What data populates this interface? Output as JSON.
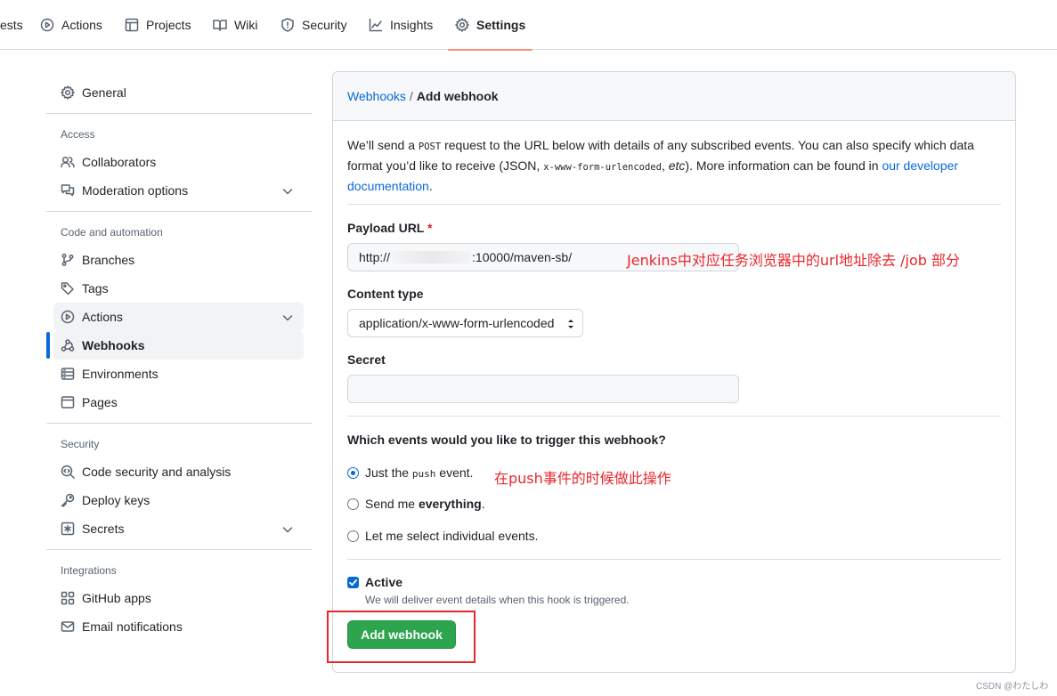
{
  "topnav": {
    "tabs": [
      {
        "label": "ests",
        "icon": "partial-tab"
      },
      {
        "label": "Actions",
        "icon": "play-icon"
      },
      {
        "label": "Projects",
        "icon": "table-icon"
      },
      {
        "label": "Wiki",
        "icon": "book-icon"
      },
      {
        "label": "Security",
        "icon": "shield-icon"
      },
      {
        "label": "Insights",
        "icon": "graph-icon"
      },
      {
        "label": "Settings",
        "icon": "gear-icon"
      }
    ],
    "selected": "Settings"
  },
  "sidebar": {
    "general": "General",
    "sections": [
      {
        "heading": "Access",
        "items": [
          "Collaborators",
          "Moderation options"
        ]
      },
      {
        "heading": "Code and automation",
        "items": [
          "Branches",
          "Tags",
          "Actions",
          "Webhooks",
          "Environments",
          "Pages"
        ]
      },
      {
        "heading": "Security",
        "items": [
          "Code security and analysis",
          "Deploy keys",
          "Secrets"
        ]
      },
      {
        "heading": "Integrations",
        "items": [
          "GitHub apps",
          "Email notifications"
        ]
      }
    ],
    "active_item": "Webhooks"
  },
  "main": {
    "breadcrumb": {
      "parent": "Webhooks",
      "separator": "/",
      "current": "Add webhook"
    },
    "description": {
      "p1": "We’ll send a ",
      "code1": "POST",
      "p2": " request to the URL below with details of any subscribed events. You can also specify which data format you’d like to receive (JSON, ",
      "code2": "x-www-form-urlencoded",
      "p3": ", ",
      "etc": "etc",
      "p4": "). More information can be found in ",
      "link": "our developer documentation",
      "p5": "."
    },
    "payload_url": {
      "label": "Payload URL",
      "required_mark": "*",
      "value_prefix": "http://",
      "value_suffix": ":10000/maven-sb/"
    },
    "content_type": {
      "label": "Content type",
      "selected": "application/x-www-form-urlencoded"
    },
    "secret": {
      "label": "Secret",
      "value": ""
    },
    "events": {
      "question": "Which events would you like to trigger this webhook?",
      "options": [
        {
          "pre": "Just the ",
          "code": "push",
          "post": " event.",
          "selected": true
        },
        {
          "pre": "Send me ",
          "bold": "everything",
          "post": ".",
          "selected": false
        },
        {
          "pre": "Let me select individual events.",
          "selected": false
        }
      ]
    },
    "active": {
      "label": "Active",
      "checked": true,
      "note": "We will deliver event details when this hook is triggered."
    },
    "submit_label": "Add webhook"
  },
  "annotations": {
    "url_note": "Jenkins中对应任务浏览器中的url地址除去 /job 部分",
    "push_note": "在push事件的时候做此操作"
  },
  "watermark": "CSDN @わたしわ",
  "colors": {
    "accent": "#0969da",
    "primary_button": "#2da44e",
    "annotation_red": "#e8262b",
    "tab_underline": "#fd8c73"
  }
}
